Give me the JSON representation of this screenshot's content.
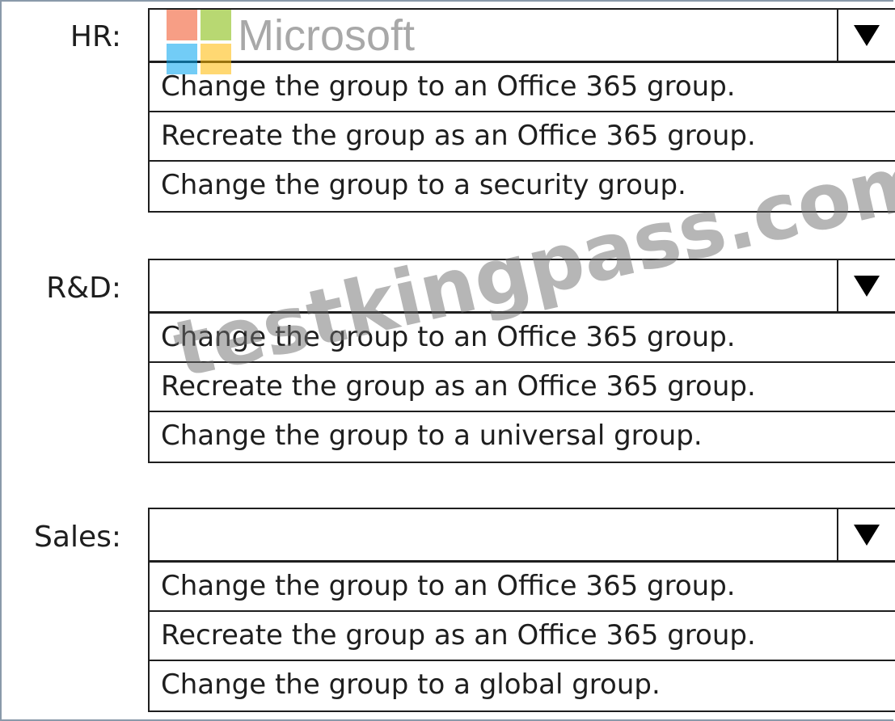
{
  "branding": {
    "wordmark": "Microsoft",
    "watermark": "testkingpass.com"
  },
  "groups": [
    {
      "label": "HR:",
      "selected": "",
      "options": [
        "Change the group to an Office 365 group.",
        "Recreate the group as an Office 365 group.",
        "Change the group to a security group."
      ]
    },
    {
      "label": "R&D:",
      "selected": "",
      "options": [
        "Change the group to an Office 365 group.",
        "Recreate the group as an Office 365 group.",
        "Change the group to a universal group."
      ]
    },
    {
      "label": "Sales:",
      "selected": "",
      "options": [
        "Change the group to an Office 365 group.",
        "Recreate the group as an Office 365 group.",
        "Change the group to a global group."
      ]
    }
  ],
  "colors": {
    "text": "#1e1e1e",
    "border": "#1e1e1e",
    "frame": "#8a9aaa",
    "logo_red": "#f25022",
    "logo_green": "#7fba00",
    "logo_blue": "#00a4ef",
    "logo_yellow": "#ffb900"
  }
}
